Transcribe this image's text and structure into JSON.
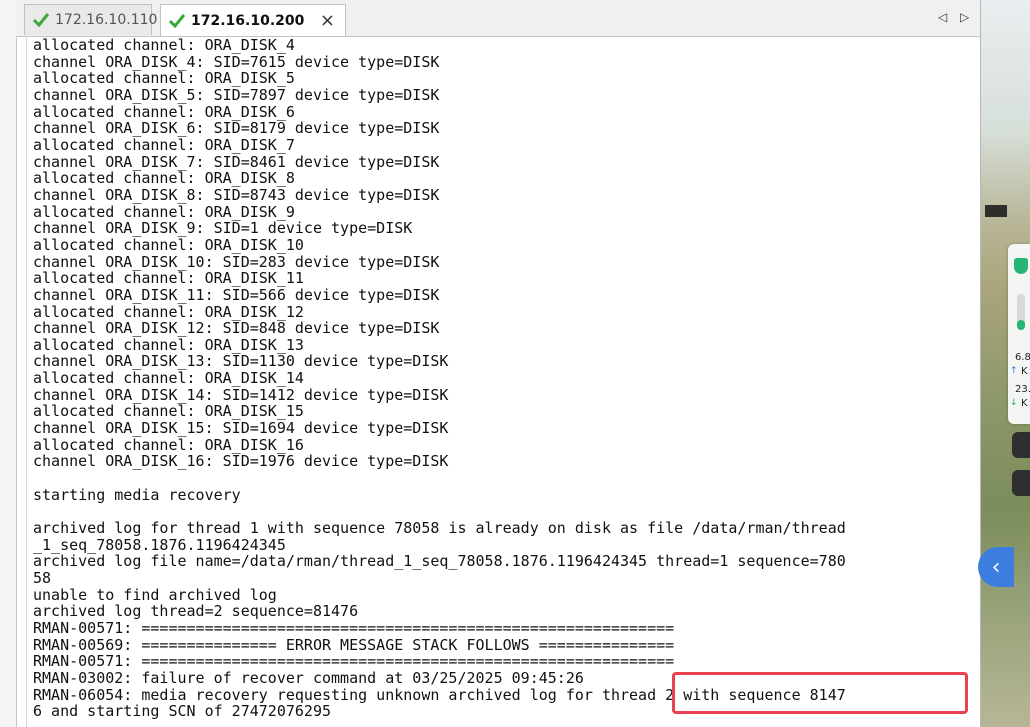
{
  "tabs": [
    {
      "label": "172.16.10.110",
      "active": false
    },
    {
      "label": "172.16.10.200",
      "active": true
    }
  ],
  "tab_close_label": "×",
  "tab_nav": {
    "prev": "◁",
    "next": "▷"
  },
  "terminal": {
    "lines": [
      "allocated channel: ORA_DISK_4",
      "channel ORA_DISK_4: SID=7615 device type=DISK",
      "allocated channel: ORA_DISK_5",
      "channel ORA_DISK_5: SID=7897 device type=DISK",
      "allocated channel: ORA_DISK_6",
      "channel ORA_DISK_6: SID=8179 device type=DISK",
      "allocated channel: ORA_DISK_7",
      "channel ORA_DISK_7: SID=8461 device type=DISK",
      "allocated channel: ORA_DISK_8",
      "channel ORA_DISK_8: SID=8743 device type=DISK",
      "allocated channel: ORA_DISK_9",
      "channel ORA_DISK_9: SID=1 device type=DISK",
      "allocated channel: ORA_DISK_10",
      "channel ORA_DISK_10: SID=283 device type=DISK",
      "allocated channel: ORA_DISK_11",
      "channel ORA_DISK_11: SID=566 device type=DISK",
      "allocated channel: ORA_DISK_12",
      "channel ORA_DISK_12: SID=848 device type=DISK",
      "allocated channel: ORA_DISK_13",
      "channel ORA_DISK_13: SID=1130 device type=DISK",
      "allocated channel: ORA_DISK_14",
      "channel ORA_DISK_14: SID=1412 device type=DISK",
      "allocated channel: ORA_DISK_15",
      "channel ORA_DISK_15: SID=1694 device type=DISK",
      "allocated channel: ORA_DISK_16",
      "channel ORA_DISK_16: SID=1976 device type=DISK",
      "",
      "starting media recovery",
      "",
      "archived log for thread 1 with sequence 78058 is already on disk as file /data/rman/thread",
      "_1_seq_78058.1876.1196424345",
      "archived log file name=/data/rman/thread_1_seq_78058.1876.1196424345 thread=1 sequence=780",
      "58",
      "unable to find archived log",
      "archived log thread=2 sequence=81476",
      "RMAN-00571: ===========================================================",
      "RMAN-00569: =============== ERROR MESSAGE STACK FOLLOWS ===============",
      "RMAN-00571: ===========================================================",
      "RMAN-03002: failure of recover command at 03/25/2025 09:45:26",
      "RMAN-06054: media recovery requesting unknown archived log for thread 2 with sequence 8147",
      "6 and starting SCN of 27472076295"
    ]
  },
  "side_widget": {
    "upload_value": "6.8",
    "upload_unit": "K",
    "download_value": "23.",
    "download_unit": "K"
  },
  "colors": {
    "highlight_border": "#e8414f",
    "check_icon": "#3aa83a",
    "floating_button": "#3c7ee0"
  }
}
